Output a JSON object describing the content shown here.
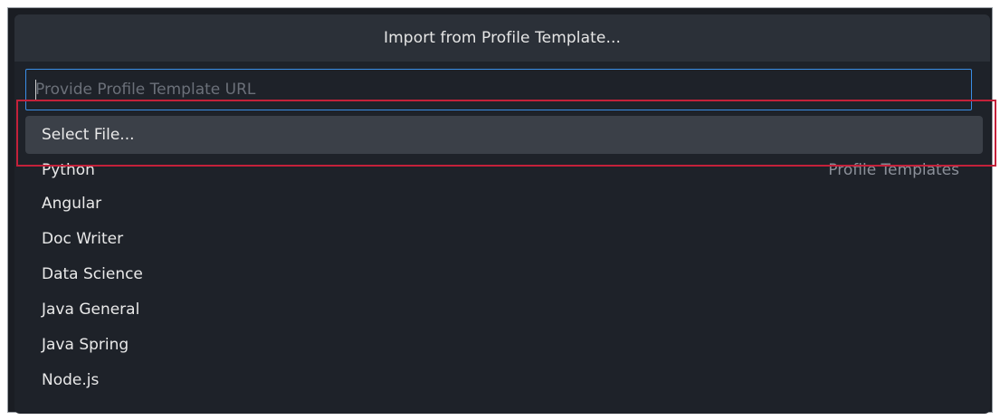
{
  "dialog": {
    "title": "Import from Profile Template..."
  },
  "input": {
    "placeholder": "Provide Profile Template URL",
    "value": ""
  },
  "items": [
    {
      "label": "Select File...",
      "group": ""
    },
    {
      "label": "Python",
      "group": "Profile Templates"
    },
    {
      "label": "Angular",
      "group": ""
    },
    {
      "label": "Doc Writer",
      "group": ""
    },
    {
      "label": "Data Science",
      "group": ""
    },
    {
      "label": "Java General",
      "group": ""
    },
    {
      "label": "Java Spring",
      "group": ""
    },
    {
      "label": "Node.js",
      "group": ""
    }
  ],
  "colors": {
    "background": "#1e2229",
    "titlebar": "#2b3038",
    "input_border": "#3a8ee6",
    "selected_item": "#3b4048",
    "annotation_box": "#c4213a"
  }
}
